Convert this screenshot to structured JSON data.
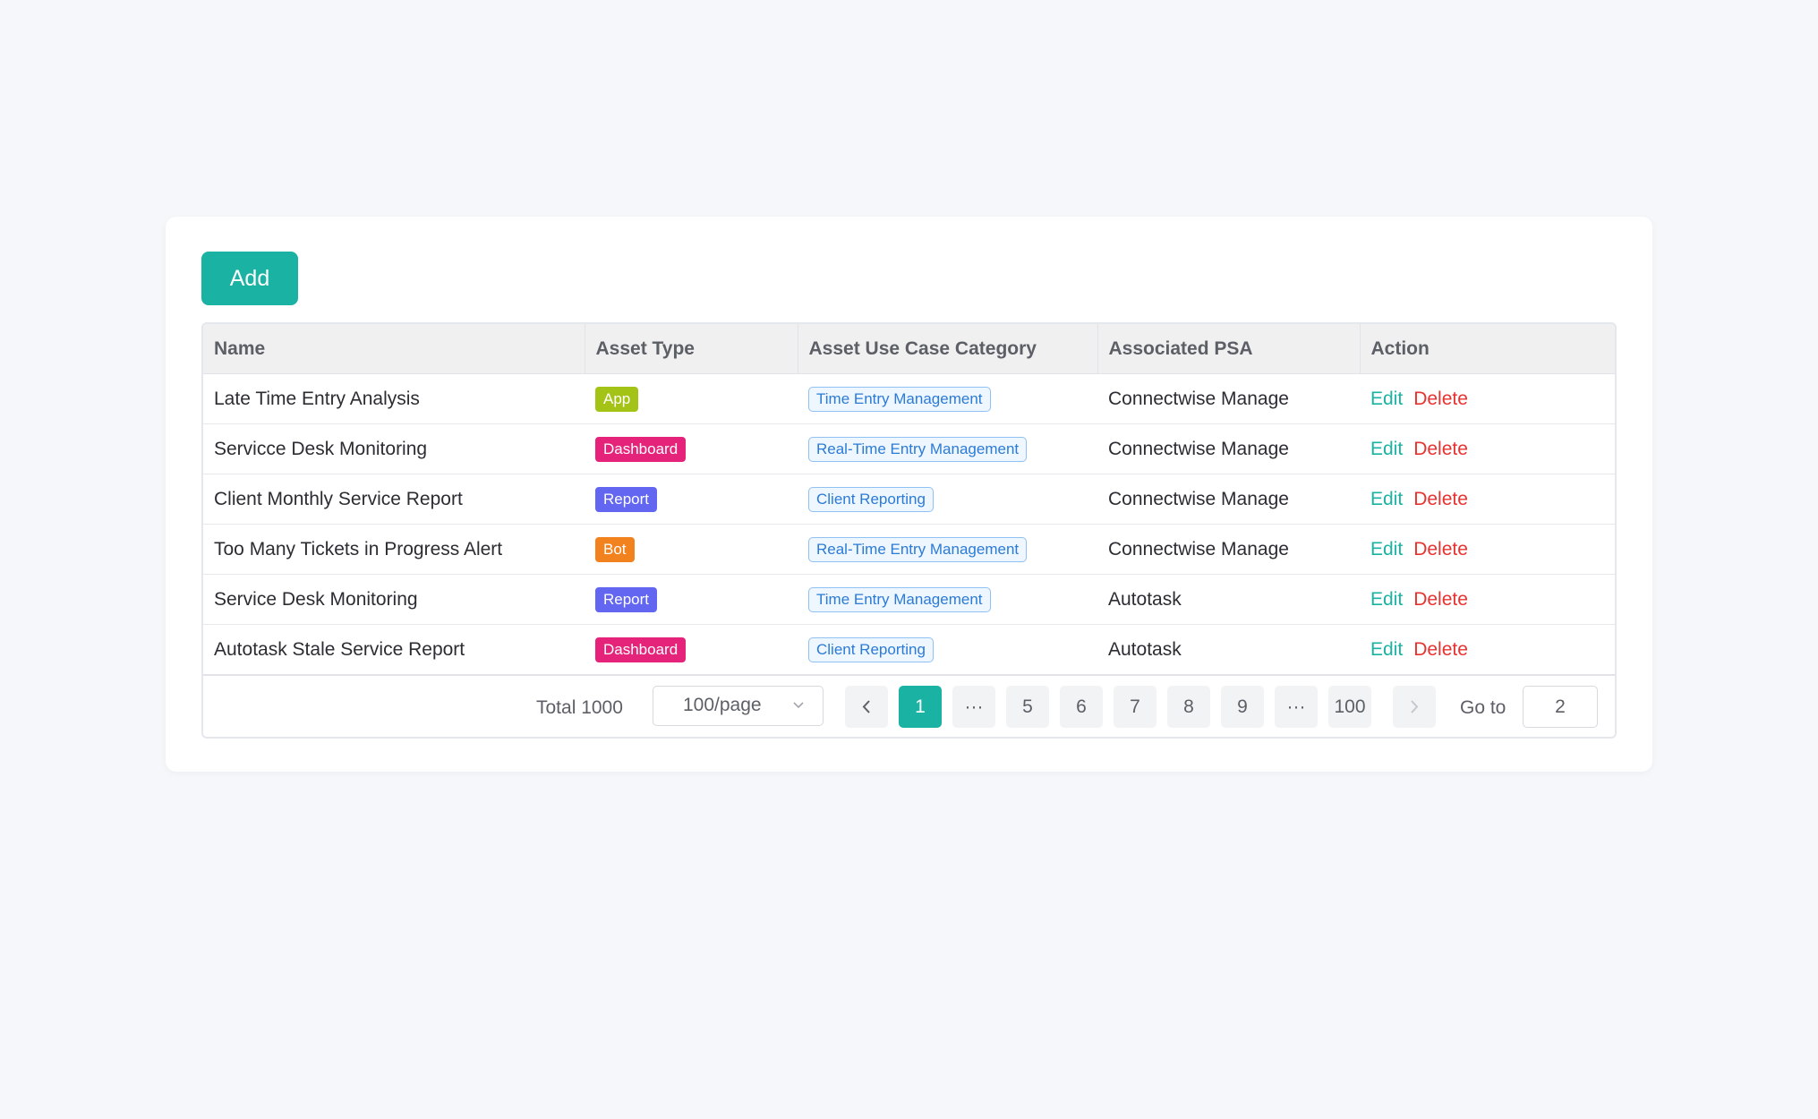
{
  "toolbar": {
    "add_label": "Add"
  },
  "colors": {
    "accent": "#1ab3a3",
    "danger": "#e8322f",
    "tag_app": "#a3c417",
    "tag_dashboard": "#e6237a",
    "tag_report": "#6366f1",
    "tag_bot": "#f2821d"
  },
  "table": {
    "columns": [
      "Name",
      "Asset Type",
      "Asset Use Case Category",
      "Associated PSA",
      "Action"
    ],
    "rows": [
      {
        "name": "Late Time Entry Analysis",
        "asset_type": "App",
        "category": "Time Entry Management",
        "psa": "Connectwise Manage",
        "edit": "Edit",
        "delete": "Delete"
      },
      {
        "name": "Servicce Desk Monitoring",
        "asset_type": "Dashboard",
        "category": "Real-Time Entry Management",
        "psa": "Connectwise Manage",
        "edit": "Edit",
        "delete": "Delete"
      },
      {
        "name": "Client Monthly Service Report",
        "asset_type": "Report",
        "category": "Client Reporting",
        "psa": "Connectwise Manage",
        "edit": "Edit",
        "delete": "Delete"
      },
      {
        "name": "Too Many Tickets in Progress Alert",
        "asset_type": "Bot",
        "category": "Real-Time Entry Management",
        "psa": "Connectwise Manage",
        "edit": "Edit",
        "delete": "Delete"
      },
      {
        "name": "Service Desk Monitoring",
        "asset_type": "Report",
        "category": "Time Entry Management",
        "psa": "Autotask",
        "edit": "Edit",
        "delete": "Delete"
      },
      {
        "name": "Autotask Stale Service Report",
        "asset_type": "Dashboard",
        "category": "Client Reporting",
        "psa": "Autotask",
        "edit": "Edit",
        "delete": "Delete"
      }
    ]
  },
  "pagination": {
    "total_label": "Total 1000",
    "page_size": "100/page",
    "prev_icon": "chevron-left-icon",
    "next_icon": "chevron-right-icon",
    "pages": [
      "1",
      "···",
      "5",
      "6",
      "7",
      "8",
      "9",
      "···",
      "100"
    ],
    "current_page": "1",
    "goto_label": "Go to",
    "goto_value": "2"
  }
}
